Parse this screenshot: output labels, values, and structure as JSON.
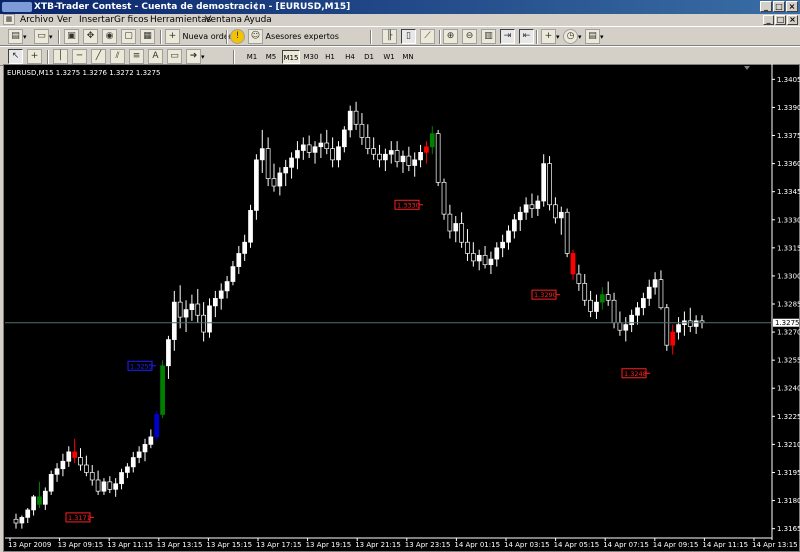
{
  "window": {
    "title": "XTB-Trader Contest - Cuenta de demostraci¢n - [EURUSD,M15]",
    "min": "_",
    "max": "□",
    "close": "×"
  },
  "menu": [
    "Archivo",
    "Ver",
    "Insertar",
    "Gr ficos",
    "Herramientas",
    "Ventana",
    "Ayuda"
  ],
  "toolbar": {
    "new_order": "Nueva orden",
    "expert_advisors": "Asesores expertos",
    "text_tool": "A",
    "timeframes": [
      "M1",
      "M5",
      "M15",
      "M30",
      "H1",
      "H4",
      "D1",
      "W1",
      "MN"
    ],
    "active_timeframe": "M15"
  },
  "chart": {
    "header": "EURUSD,M15  1.3275 1.3276 1.3272 1.3275",
    "bg": "#000000",
    "bull": "#ffffff",
    "bear": "#ffffff",
    "highlight_green": "#008000",
    "highlight_red": "#ff0000",
    "highlight_blue": "#0000cc"
  },
  "chart_data": {
    "type": "candlestick",
    "symbol": "EURUSD",
    "timeframe": "M15",
    "ohlc_last": {
      "open": 1.3275,
      "high": 1.3276,
      "low": 1.3272,
      "close": 1.3275
    },
    "ylim": [
      1.316,
      1.341
    ],
    "y_ticks": [
      "1.3405",
      "1.3390",
      "1.3375",
      "1.3360",
      "1.3345",
      "1.3330",
      "1.3315",
      "1.3300",
      "1.3285",
      "1.3270",
      "1.3255",
      "1.3240",
      "1.3225",
      "1.3210",
      "1.3195",
      "1.3180",
      "1.3165"
    ],
    "current_price": "1.3275",
    "x_ticks": [
      "13 Apr 2009",
      "13 Apr 09:15",
      "13 Apr 11:15",
      "13 Apr 13:15",
      "13 Apr 15:15",
      "13 Apr 17:15",
      "13 Apr 19:15",
      "13 Apr 21:15",
      "13 Apr 23:15",
      "14 Apr 01:15",
      "14 Apr 03:15",
      "14 Apr 05:15",
      "14 Apr 07:15",
      "14 Apr 09:15",
      "14 Apr 11:15",
      "14 Apr 13:15"
    ],
    "price_labels": [
      {
        "text": "1.3171",
        "color": "red",
        "price": 1.3171
      },
      {
        "text": "1.3255",
        "color": "blue",
        "price": 1.3252
      },
      {
        "text": "1.3330",
        "color": "red",
        "price": 1.3338
      },
      {
        "text": "1.3290",
        "color": "red",
        "price": 1.329
      },
      {
        "text": "1.3248",
        "color": "red",
        "price": 1.3248
      }
    ],
    "candles": [
      [
        1.317,
        1.3173,
        1.3165,
        1.3168
      ],
      [
        1.3168,
        1.3172,
        1.3165,
        1.3171
      ],
      [
        1.3171,
        1.3176,
        1.3168,
        1.3175
      ],
      [
        1.3175,
        1.3183,
        1.3172,
        1.3182
      ],
      [
        1.3182,
        1.319,
        1.3176,
        1.3178
      ],
      [
        1.3178,
        1.3187,
        1.3175,
        1.3185
      ],
      [
        1.3185,
        1.3196,
        1.3183,
        1.3194
      ],
      [
        1.3194,
        1.32,
        1.319,
        1.3197
      ],
      [
        1.3197,
        1.3205,
        1.3193,
        1.3201
      ],
      [
        1.3201,
        1.3209,
        1.3198,
        1.3206
      ],
      [
        1.3206,
        1.3213,
        1.32,
        1.3203
      ],
      [
        1.3203,
        1.3208,
        1.3196,
        1.3199
      ],
      [
        1.3199,
        1.3204,
        1.3193,
        1.3195
      ],
      [
        1.3195,
        1.3199,
        1.3188,
        1.3191
      ],
      [
        1.3191,
        1.3196,
        1.3183,
        1.3185
      ],
      [
        1.3185,
        1.3192,
        1.3183,
        1.319
      ],
      [
        1.319,
        1.3193,
        1.3184,
        1.3186
      ],
      [
        1.3186,
        1.3192,
        1.3182,
        1.3189
      ],
      [
        1.3189,
        1.3197,
        1.3186,
        1.3195
      ],
      [
        1.3195,
        1.32,
        1.3192,
        1.3198
      ],
      [
        1.3198,
        1.3206,
        1.3195,
        1.3203
      ],
      [
        1.3203,
        1.3209,
        1.32,
        1.3206
      ],
      [
        1.3206,
        1.3213,
        1.3201,
        1.321
      ],
      [
        1.321,
        1.3218,
        1.3208,
        1.3214
      ],
      [
        1.3214,
        1.3228,
        1.3212,
        1.3226
      ],
      [
        1.3226,
        1.3255,
        1.3224,
        1.3252
      ],
      [
        1.3252,
        1.3268,
        1.3245,
        1.3266
      ],
      [
        1.3266,
        1.3292,
        1.326,
        1.3286
      ],
      [
        1.3286,
        1.3295,
        1.3272,
        1.3278
      ],
      [
        1.3278,
        1.3287,
        1.327,
        1.3282
      ],
      [
        1.3282,
        1.329,
        1.3276,
        1.3285
      ],
      [
        1.3285,
        1.3293,
        1.3275,
        1.3279
      ],
      [
        1.3279,
        1.3286,
        1.3265,
        1.327
      ],
      [
        1.327,
        1.3288,
        1.3267,
        1.3284
      ],
      [
        1.3284,
        1.3292,
        1.3278,
        1.3288
      ],
      [
        1.3288,
        1.3296,
        1.3282,
        1.3292
      ],
      [
        1.3292,
        1.33,
        1.3288,
        1.3297
      ],
      [
        1.3297,
        1.3308,
        1.3295,
        1.3305
      ],
      [
        1.3305,
        1.3316,
        1.3301,
        1.3312
      ],
      [
        1.3312,
        1.3322,
        1.3308,
        1.3318
      ],
      [
        1.3318,
        1.3338,
        1.3315,
        1.3335
      ],
      [
        1.3335,
        1.3365,
        1.333,
        1.3362
      ],
      [
        1.3362,
        1.3378,
        1.3355,
        1.3368
      ],
      [
        1.3368,
        1.3374,
        1.3348,
        1.3352
      ],
      [
        1.3352,
        1.336,
        1.3345,
        1.3348
      ],
      [
        1.3348,
        1.3358,
        1.3343,
        1.3355
      ],
      [
        1.3355,
        1.3362,
        1.3348,
        1.3358
      ],
      [
        1.3358,
        1.3366,
        1.3352,
        1.3363
      ],
      [
        1.3363,
        1.3372,
        1.3357,
        1.3367
      ],
      [
        1.3367,
        1.3374,
        1.3362,
        1.337
      ],
      [
        1.337,
        1.3375,
        1.3363,
        1.3366
      ],
      [
        1.3366,
        1.3372,
        1.336,
        1.3369
      ],
      [
        1.3369,
        1.3376,
        1.3363,
        1.3371
      ],
      [
        1.3371,
        1.3378,
        1.3365,
        1.3368
      ],
      [
        1.3368,
        1.3374,
        1.3358,
        1.3362
      ],
      [
        1.3362,
        1.3372,
        1.3358,
        1.3369
      ],
      [
        1.3369,
        1.338,
        1.3366,
        1.3378
      ],
      [
        1.3378,
        1.3391,
        1.3374,
        1.3388
      ],
      [
        1.3388,
        1.3393,
        1.3378,
        1.3381
      ],
      [
        1.3381,
        1.3387,
        1.337,
        1.3374
      ],
      [
        1.3374,
        1.3381,
        1.3365,
        1.3368
      ],
      [
        1.3368,
        1.3374,
        1.3362,
        1.3365
      ],
      [
        1.3365,
        1.337,
        1.3358,
        1.3362
      ],
      [
        1.3362,
        1.3368,
        1.3356,
        1.3365
      ],
      [
        1.3365,
        1.3372,
        1.336,
        1.3367
      ],
      [
        1.3367,
        1.3372,
        1.3358,
        1.3361
      ],
      [
        1.3361,
        1.3367,
        1.3355,
        1.3364
      ],
      [
        1.3364,
        1.3369,
        1.3356,
        1.3359
      ],
      [
        1.3359,
        1.3366,
        1.3353,
        1.3362
      ],
      [
        1.3362,
        1.337,
        1.3358,
        1.3366
      ],
      [
        1.3366,
        1.3372,
        1.336,
        1.3369
      ],
      [
        1.3369,
        1.338,
        1.3365,
        1.3376
      ],
      [
        1.3376,
        1.3378,
        1.3348,
        1.335
      ],
      [
        1.335,
        1.3352,
        1.333,
        1.3333
      ],
      [
        1.3333,
        1.3338,
        1.332,
        1.3324
      ],
      [
        1.3324,
        1.3332,
        1.3318,
        1.3328
      ],
      [
        1.3328,
        1.3334,
        1.3315,
        1.3318
      ],
      [
        1.3318,
        1.3325,
        1.3308,
        1.3312
      ],
      [
        1.3312,
        1.3318,
        1.3305,
        1.3308
      ],
      [
        1.3308,
        1.3314,
        1.3303,
        1.3311
      ],
      [
        1.3311,
        1.3316,
        1.3304,
        1.3306
      ],
      [
        1.3306,
        1.3313,
        1.3301,
        1.3309
      ],
      [
        1.3309,
        1.3318,
        1.3305,
        1.3315
      ],
      [
        1.3315,
        1.3322,
        1.331,
        1.3318
      ],
      [
        1.3318,
        1.3327,
        1.3314,
        1.3324
      ],
      [
        1.3324,
        1.3333,
        1.332,
        1.333
      ],
      [
        1.333,
        1.3337,
        1.3324,
        1.3334
      ],
      [
        1.3334,
        1.3342,
        1.333,
        1.3338
      ],
      [
        1.3338,
        1.3344,
        1.3331,
        1.3336
      ],
      [
        1.3336,
        1.3343,
        1.3332,
        1.334
      ],
      [
        1.334,
        1.3365,
        1.3337,
        1.336
      ],
      [
        1.336,
        1.3364,
        1.3335,
        1.3338
      ],
      [
        1.3338,
        1.3342,
        1.3328,
        1.3331
      ],
      [
        1.3331,
        1.3337,
        1.3322,
        1.3334
      ],
      [
        1.3334,
        1.3336,
        1.331,
        1.3312
      ],
      [
        1.3312,
        1.3314,
        1.3298,
        1.3301
      ],
      [
        1.3301,
        1.3306,
        1.3292,
        1.3296
      ],
      [
        1.3296,
        1.3301,
        1.3284,
        1.3287
      ],
      [
        1.3287,
        1.3292,
        1.3278,
        1.3281
      ],
      [
        1.3281,
        1.329,
        1.3277,
        1.3286
      ],
      [
        1.3286,
        1.3294,
        1.3282,
        1.329
      ],
      [
        1.329,
        1.3297,
        1.3284,
        1.3287
      ],
      [
        1.3287,
        1.3291,
        1.3272,
        1.3275
      ],
      [
        1.3275,
        1.3281,
        1.3268,
        1.3271
      ],
      [
        1.3271,
        1.3278,
        1.3265,
        1.3274
      ],
      [
        1.3274,
        1.3282,
        1.327,
        1.3279
      ],
      [
        1.3279,
        1.3286,
        1.3274,
        1.3283
      ],
      [
        1.3283,
        1.3291,
        1.3279,
        1.3288
      ],
      [
        1.3288,
        1.3298,
        1.3284,
        1.3294
      ],
      [
        1.3294,
        1.3302,
        1.329,
        1.3298
      ],
      [
        1.3298,
        1.3303,
        1.3282,
        1.3283
      ],
      [
        1.3283,
        1.3285,
        1.326,
        1.3263
      ],
      [
        1.3263,
        1.3274,
        1.3258,
        1.327
      ],
      [
        1.327,
        1.3278,
        1.3266,
        1.3274
      ],
      [
        1.3274,
        1.3281,
        1.3268,
        1.3276
      ],
      [
        1.3276,
        1.3283,
        1.327,
        1.3273
      ],
      [
        1.3273,
        1.3279,
        1.3269,
        1.3276
      ],
      [
        1.3276,
        1.3279,
        1.3272,
        1.3275
      ]
    ],
    "highlight": {
      "green": [
        4,
        25,
        71,
        100
      ],
      "red": [
        10,
        70,
        95,
        112
      ],
      "blue": [
        24
      ]
    }
  }
}
